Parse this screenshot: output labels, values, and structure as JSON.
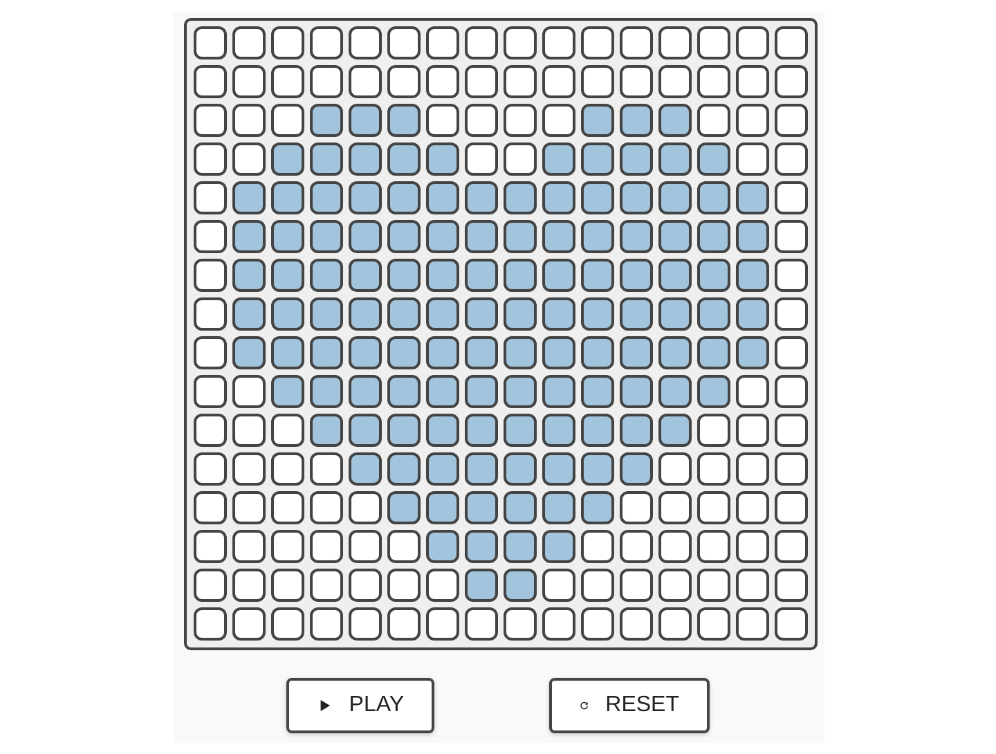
{
  "grid": [
    [
      false,
      false,
      false,
      false,
      false,
      false,
      false,
      false,
      false,
      false,
      false,
      false,
      false,
      false,
      false,
      false
    ],
    [
      false,
      false,
      false,
      false,
      false,
      false,
      false,
      false,
      false,
      false,
      false,
      false,
      false,
      false,
      false,
      false
    ],
    [
      false,
      false,
      false,
      true,
      true,
      true,
      false,
      false,
      false,
      false,
      true,
      true,
      true,
      false,
      false,
      false
    ],
    [
      false,
      false,
      true,
      true,
      true,
      true,
      true,
      false,
      false,
      true,
      true,
      true,
      true,
      true,
      false,
      false
    ],
    [
      false,
      true,
      true,
      true,
      true,
      true,
      true,
      true,
      true,
      true,
      true,
      true,
      true,
      true,
      true,
      false
    ],
    [
      false,
      true,
      true,
      true,
      true,
      true,
      true,
      true,
      true,
      true,
      true,
      true,
      true,
      true,
      true,
      false
    ],
    [
      false,
      true,
      true,
      true,
      true,
      true,
      true,
      true,
      true,
      true,
      true,
      true,
      true,
      true,
      true,
      false
    ],
    [
      false,
      true,
      true,
      true,
      true,
      true,
      true,
      true,
      true,
      true,
      true,
      true,
      true,
      true,
      true,
      false
    ],
    [
      false,
      true,
      true,
      true,
      true,
      true,
      true,
      true,
      true,
      true,
      true,
      true,
      true,
      true,
      true,
      false
    ],
    [
      false,
      false,
      true,
      true,
      true,
      true,
      true,
      true,
      true,
      true,
      true,
      true,
      true,
      true,
      false,
      false
    ],
    [
      false,
      false,
      false,
      true,
      true,
      true,
      true,
      true,
      true,
      true,
      true,
      true,
      true,
      false,
      false,
      false
    ],
    [
      false,
      false,
      false,
      false,
      true,
      true,
      true,
      true,
      true,
      true,
      true,
      true,
      false,
      false,
      false,
      false
    ],
    [
      false,
      false,
      false,
      false,
      false,
      true,
      true,
      true,
      true,
      true,
      true,
      false,
      false,
      false,
      false,
      false
    ],
    [
      false,
      false,
      false,
      false,
      false,
      false,
      true,
      true,
      true,
      true,
      false,
      false,
      false,
      false,
      false,
      false
    ],
    [
      false,
      false,
      false,
      false,
      false,
      false,
      false,
      true,
      true,
      false,
      false,
      false,
      false,
      false,
      false,
      false
    ],
    [
      false,
      false,
      false,
      false,
      false,
      false,
      false,
      false,
      false,
      false,
      false,
      false,
      false,
      false,
      false,
      false
    ]
  ],
  "buttons": [
    {
      "kind": "play",
      "label": "PLAY"
    },
    {
      "kind": "reset",
      "label": "RESET"
    }
  ]
}
